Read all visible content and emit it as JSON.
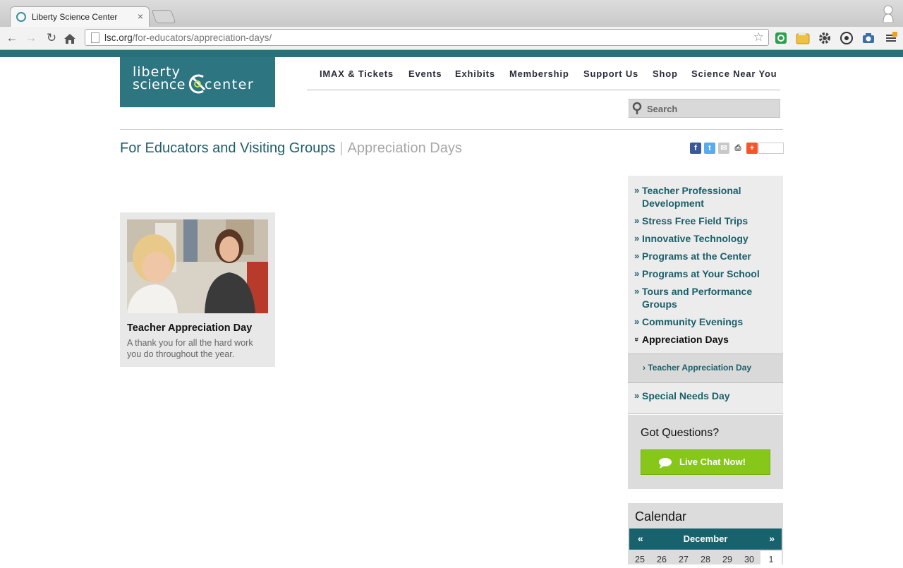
{
  "browser": {
    "tab_title": "Liberty Science Center",
    "tab_close": "×",
    "url_domain": "lsc.org",
    "url_path": "/for-educators/appreciation-days/"
  },
  "logo": {
    "line1": "liberty",
    "line2": "science",
    "line3": "center"
  },
  "nav": {
    "items": [
      "IMAX & Tickets",
      "Events",
      "Exhibits",
      "Membership",
      "Support Us",
      "Shop",
      "Science Near You"
    ]
  },
  "search": {
    "placeholder": "Search"
  },
  "heading": {
    "main": "For Educators and Visiting Groups",
    "separator": "|",
    "sub": "Appreciation Days"
  },
  "card": {
    "title": "Teacher Appreciation Day",
    "description": "A thank you for all the hard work you do throughout the year."
  },
  "sidebar": {
    "bullet": "»",
    "active_bullet": "»",
    "items": [
      "Teacher Professional Development",
      "Stress Free Field Trips",
      "Innovative Technology",
      "Programs at the Center",
      "Programs at Your School",
      "Tours and Performance Groups",
      "Community Evenings",
      "Appreciation Days",
      "Special Needs Day"
    ],
    "sub_item": "› Teacher Appreciation Day"
  },
  "questions": {
    "title": "Got Questions?",
    "chat_label": "Live Chat Now!"
  },
  "calendar": {
    "title": "Calendar",
    "prev": "«",
    "next": "»",
    "month": "December",
    "days": [
      "25",
      "26",
      "27",
      "28",
      "29",
      "30",
      "1"
    ]
  },
  "colors": {
    "brand_teal": "#2e7582",
    "link_teal": "#1b5f6a",
    "chat_green": "#86c71a"
  }
}
